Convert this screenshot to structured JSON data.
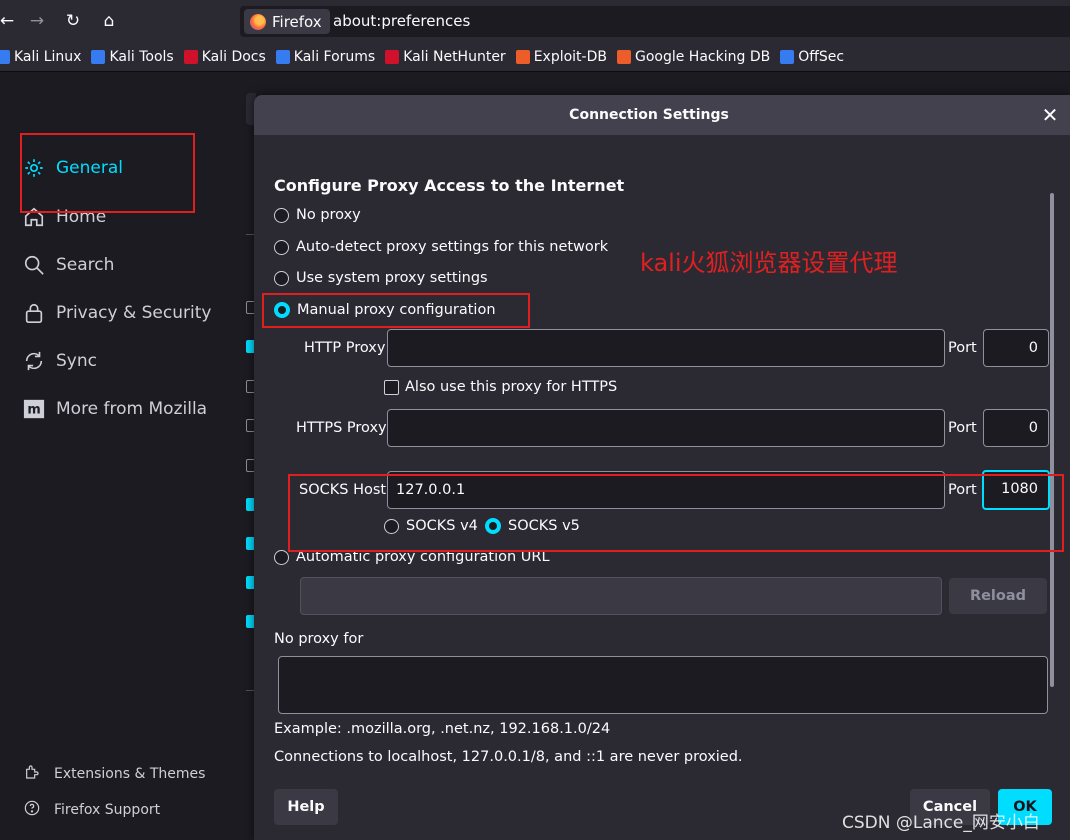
{
  "browser": {
    "identity_label": "Firefox",
    "url": "about:preferences"
  },
  "bookmarks": [
    {
      "label": "Kali Linux",
      "icon": "kali-icon",
      "color": "#367bf0"
    },
    {
      "label": "Kali Tools",
      "icon": "kali-tools-icon",
      "color": "#367bf0"
    },
    {
      "label": "Kali Docs",
      "icon": "kali-docs-icon",
      "color": "#d0112b"
    },
    {
      "label": "Kali Forums",
      "icon": "kali-forums-icon",
      "color": "#367bf0"
    },
    {
      "label": "Kali NetHunter",
      "icon": "nethunter-icon",
      "color": "#d0112b"
    },
    {
      "label": "Exploit-DB",
      "icon": "exploitdb-icon",
      "color": "#ec5d29"
    },
    {
      "label": "Google Hacking DB",
      "icon": "ghdb-icon",
      "color": "#ec5d29"
    },
    {
      "label": "OffSec",
      "icon": "offsec-icon",
      "color": "#367bf0"
    }
  ],
  "sidebar": {
    "items": [
      {
        "label": "General",
        "icon": "gear-icon",
        "selected": true
      },
      {
        "label": "Home",
        "icon": "home-icon"
      },
      {
        "label": "Search",
        "icon": "search-icon"
      },
      {
        "label": "Privacy & Security",
        "icon": "lock-icon"
      },
      {
        "label": "Sync",
        "icon": "sync-icon"
      },
      {
        "label": "More from Mozilla",
        "icon": "mozilla-icon"
      }
    ],
    "footer": [
      {
        "label": "Extensions & Themes",
        "icon": "puzzle-icon"
      },
      {
        "label": "Firefox Support",
        "icon": "help-icon"
      }
    ]
  },
  "dialog": {
    "title": "Connection Settings",
    "heading": "Configure Proxy Access to the Internet",
    "proxy_options": [
      {
        "label": "No proxy",
        "selected": false
      },
      {
        "label": "Auto-detect proxy settings for this network",
        "selected": false
      },
      {
        "label": "Use system proxy settings",
        "selected": false
      },
      {
        "label": "Manual proxy configuration",
        "selected": true
      }
    ],
    "http_proxy": {
      "label": "HTTP Proxy",
      "value": "",
      "port_label": "Port",
      "port": "0"
    },
    "also_https_label": "Also use this proxy for HTTPS",
    "https_proxy": {
      "label": "HTTPS Proxy",
      "value": "",
      "port_label": "Port",
      "port": "0"
    },
    "socks": {
      "label": "SOCKS Host",
      "value": "127.0.0.1",
      "port_label": "Port",
      "port": "1080"
    },
    "socks_versions": [
      {
        "label": "SOCKS v4",
        "selected": false
      },
      {
        "label": "SOCKS v5",
        "selected": true
      }
    ],
    "auto_url_label": "Automatic proxy configuration URL",
    "reload_label": "Reload",
    "no_proxy_label": "No proxy for",
    "example_text": "Example: .mozilla.org, .net.nz, 192.168.1.0/24",
    "localhost_note": "Connections to localhost, 127.0.0.1/8, and ::1 are never proxied.",
    "help_label": "Help",
    "cancel_label": "Cancel",
    "ok_label": "OK"
  },
  "annotation_text": "kali火狐浏览器设置代理",
  "watermark": "CSDN @Lance_网安小白",
  "colors": {
    "accent": "#00ddff",
    "annotation_red": "#e02020"
  }
}
